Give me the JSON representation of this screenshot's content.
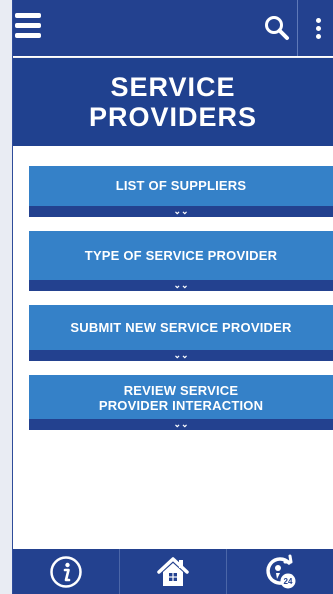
{
  "header": {
    "menu_icon": "hamburger-icon",
    "search_icon": "search-icon",
    "more_icon": "more-vertical-icon"
  },
  "banner": {
    "title": "SERVICE\nPROVIDERS"
  },
  "menu": {
    "items": [
      {
        "label": "LIST OF SUPPLIERS",
        "expand_icon": "chevron-double-down-icon"
      },
      {
        "label": "TYPE OF SERVICE PROVIDER",
        "expand_icon": "chevron-double-down-icon"
      },
      {
        "label": "SUBMIT NEW SERVICE PROVIDER",
        "expand_icon": "chevron-double-down-icon"
      },
      {
        "label": "REVIEW SERVICE\nPROVIDER INTERACTION",
        "expand_icon": "chevron-double-down-icon"
      }
    ]
  },
  "bottom_nav": {
    "info_icon": "info-icon",
    "home_icon": "home-icon",
    "support_icon": "support-24-icon",
    "support_badge": "24"
  },
  "colors": {
    "primary": "#23418f",
    "accent": "#3581c8",
    "background": "#ffffff"
  }
}
